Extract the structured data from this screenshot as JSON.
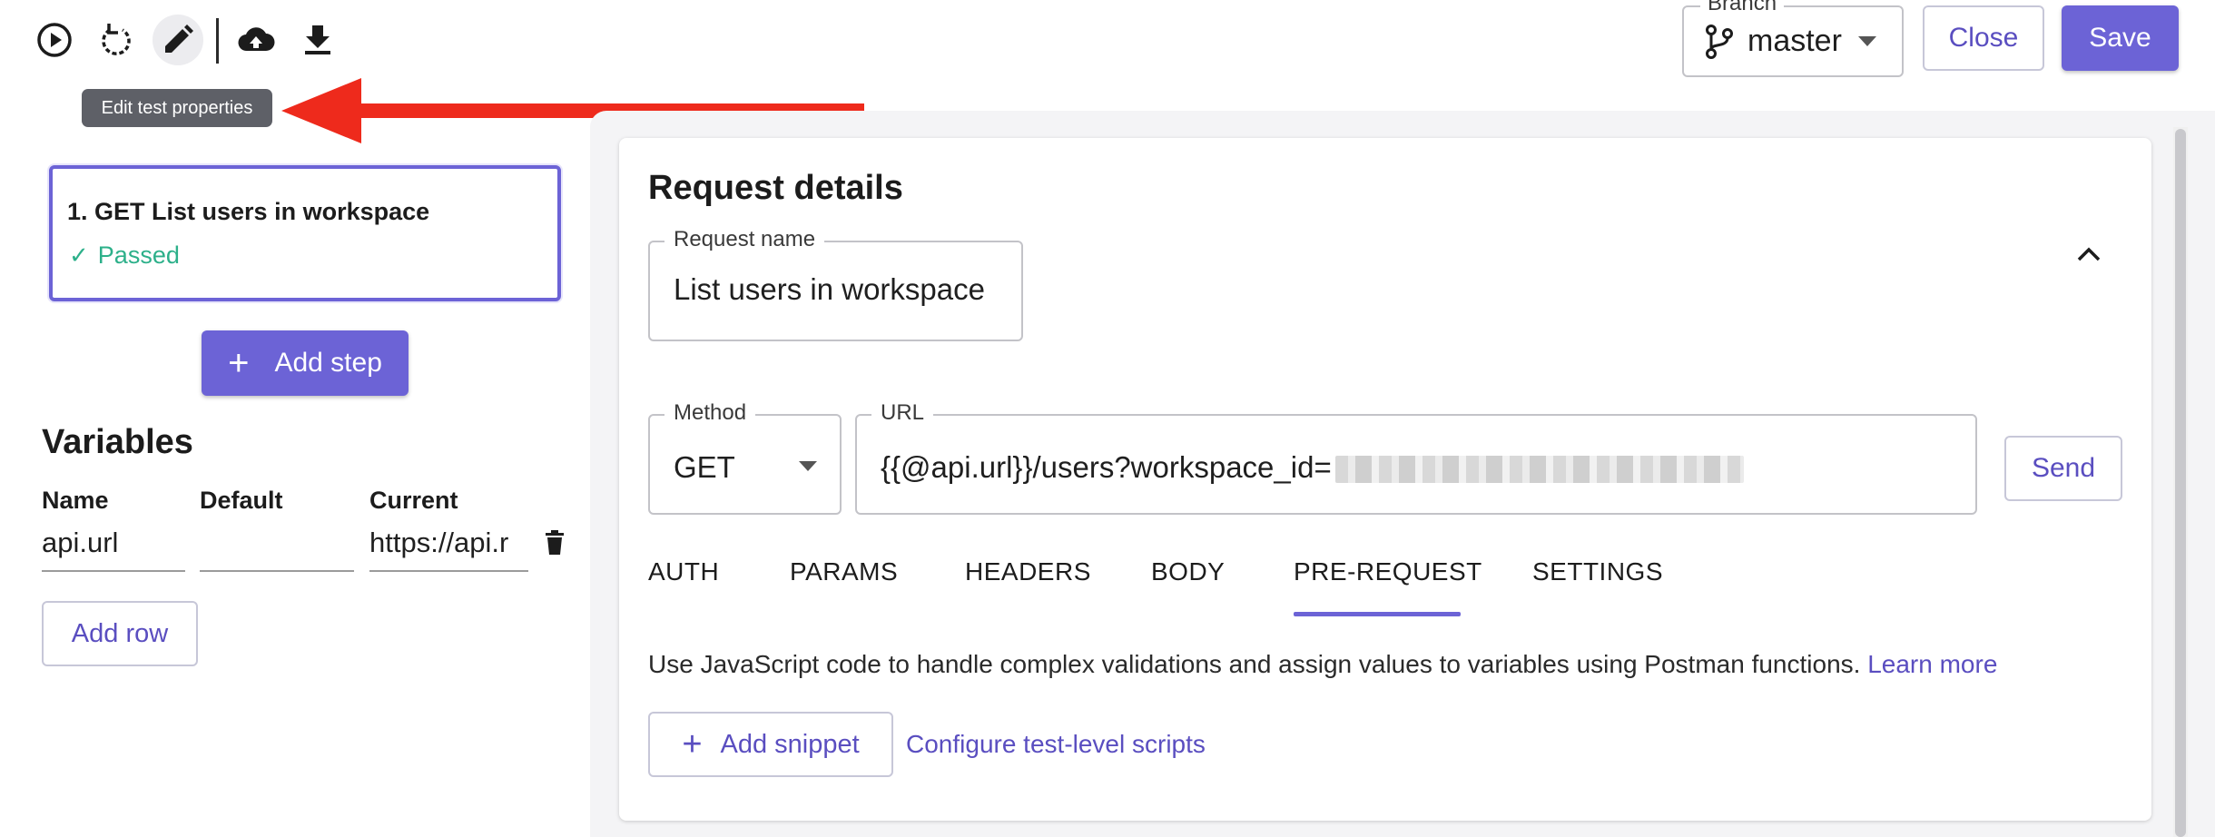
{
  "toolbar": {
    "icons": [
      "play-icon",
      "reload-icon",
      "edit-icon",
      "cloud-upload-icon",
      "download-icon"
    ],
    "tooltip": "Edit test properties"
  },
  "annotation": {
    "arrow_color": "#ee2a1c"
  },
  "header": {
    "branch_label": "Branch",
    "branch_value": "master",
    "close_label": "Close",
    "save_label": "Save"
  },
  "steps": [
    {
      "title": "1. GET List users in workspace",
      "status": "Passed"
    }
  ],
  "add_step_label": "Add step",
  "variables": {
    "title": "Variables",
    "columns": [
      "Name",
      "Default",
      "Current"
    ],
    "rows": [
      {
        "name": "api.url",
        "default": "",
        "current": "https://api.r"
      }
    ],
    "add_row_label": "Add row"
  },
  "request": {
    "title": "Request details",
    "name_label": "Request name",
    "name_value": "List users in workspace",
    "method_label": "Method",
    "method_value": "GET",
    "url_label": "URL",
    "url_value": "{{@api.url}}/users?workspace_id=",
    "send_label": "Send",
    "tabs": [
      "AUTH",
      "PARAMS",
      "HEADERS",
      "BODY",
      "PRE-REQUEST",
      "SETTINGS"
    ],
    "active_tab": "PRE-REQUEST",
    "description": "Use JavaScript code to handle complex validations and assign values to variables using Postman functions.",
    "learn_more": "Learn more",
    "add_snippet_label": "Add snippet",
    "configure_link": "Configure test-level scripts"
  },
  "colors": {
    "accent": "#6c63d6",
    "success": "#2db08a",
    "link": "#5a4ec0"
  }
}
